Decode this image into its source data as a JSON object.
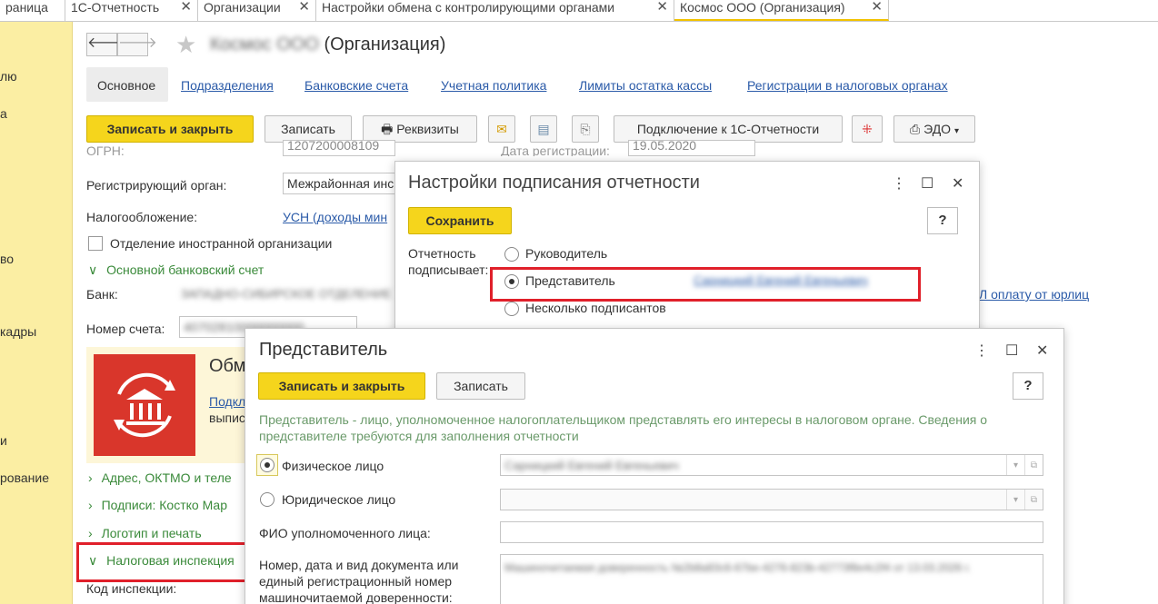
{
  "tabs": [
    {
      "label": "раница"
    },
    {
      "label": "1С-Отчетность"
    },
    {
      "label": "Организации"
    },
    {
      "label": "Настройки обмена с контролирующими органами"
    },
    {
      "label": "Космос ООО (Организация)"
    }
  ],
  "sidebar": {
    "items": [
      "лю",
      "а",
      "во",
      "кадры",
      "и",
      "рование"
    ]
  },
  "form": {
    "title_blurred": "Космос ООО",
    "title_suffix": "(Организация)",
    "tabs": [
      "Основное",
      "Подразделения",
      "Банковские счета",
      "Учетная политика",
      "Лимиты остатка кассы",
      "Регистрации в налоговых органах"
    ],
    "toolbar": {
      "save_close": "Записать и закрыть",
      "save": "Записать",
      "requisites": "Реквизиты",
      "connect": "Подключение к 1С-Отчетности",
      "edo": "ЭДО"
    },
    "ogrn_label": "ОГРН:",
    "ogrn_value": "1207200008109",
    "reg_date_label": "Дата регистрации:",
    "reg_date_value": "19.05.2020",
    "reg_org_label": "Регистрирующий орган:",
    "reg_org_value": "Межрайонная инс",
    "tax_label": "Налогообложение:",
    "tax_value": "УСН (доходы мин",
    "foreign_label": "Отделение иностранной организации",
    "bank_section": "Основной банковский счет",
    "bank_label": "Банк:",
    "bank_value": "ЗАПАДНО-СИБИРСКОЕ ОТДЕЛЕНИЕ",
    "account_label": "Номер счета:",
    "account_value": "40702810000000000",
    "banner_title": "Обм",
    "banner_link": "Подкл",
    "banner_text": "выпис",
    "right_link": "Л оплату от юрлиц",
    "sections": [
      "Адрес, ОКТМО и теле",
      "Подписи: Костко Мар",
      "Логотип и печать",
      "Налоговая инспекция"
    ],
    "inspection_code_label": "Код инспекции:"
  },
  "sign_dialog": {
    "title": "Настройки подписания отчетности",
    "save": "Сохранить",
    "help": "?",
    "label": "Отчетность подписывает:",
    "options": [
      "Руководитель",
      "Представитель",
      "Несколько подписантов"
    ],
    "selected": "Представитель",
    "representative_name": "Сарницкий Евгений Евгеньевич"
  },
  "rep_dialog": {
    "title": "Представитель",
    "save_close": "Записать и закрыть",
    "save": "Записать",
    "help": "?",
    "hint": "Представитель - лицо, уполномоченное налогоплательщиком представлять его интересы в налоговом органе. Сведения о представителе требуются для заполнения отчетности",
    "physical_label": "Физическое лицо",
    "physical_value": "Сарницкий Евгений Евгеньевич",
    "legal_label": "Юридическое лицо",
    "selected": "Физическое лицо",
    "fio_label": "ФИО уполномоченного лица:",
    "doc_label": "Номер, дата и вид документа или единый регистрационный номер машиночитаемой доверенности:",
    "doc_value": "Машиночитаемая доверенность №2b8a83c6-67be-4276-823b-42773f8e4c2f4 от 13.03.2026 г."
  },
  "colors": {
    "accent_yellow": "#f5d51c",
    "sidebar": "#fbeea3",
    "link": "#2a5aa8",
    "section_green": "#3a8a3a",
    "highlight_red": "#e0202a"
  }
}
